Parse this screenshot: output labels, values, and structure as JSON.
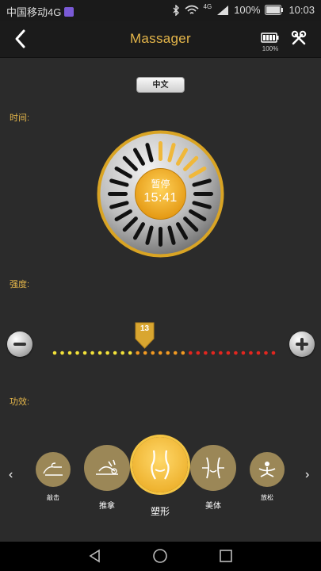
{
  "statusbar": {
    "carrier": "中国移动4G",
    "battery_pct": "100%",
    "signal": "4G",
    "time": "10:03"
  },
  "topbar": {
    "title": "Massager",
    "battery_label": "100%"
  },
  "lang_button": "中文",
  "labels": {
    "time": "时间:",
    "intensity": "强度:",
    "function": "功效:"
  },
  "timer": {
    "state": "暂停",
    "remaining": "15:41"
  },
  "intensity": {
    "value": "13",
    "level": 13,
    "max": 30
  },
  "modes": [
    {
      "label": "敲击",
      "icon": "knock-icon",
      "selected": false
    },
    {
      "label": "推拿",
      "icon": "massage-icon",
      "selected": false
    },
    {
      "label": "塑形",
      "icon": "body-shape-icon",
      "selected": true
    },
    {
      "label": "美体",
      "icon": "waist-icon",
      "selected": false
    },
    {
      "label": "放松",
      "icon": "relax-icon",
      "selected": false
    }
  ],
  "colors": {
    "accent": "#e5b64a",
    "mode_bg": "#9b8757"
  }
}
